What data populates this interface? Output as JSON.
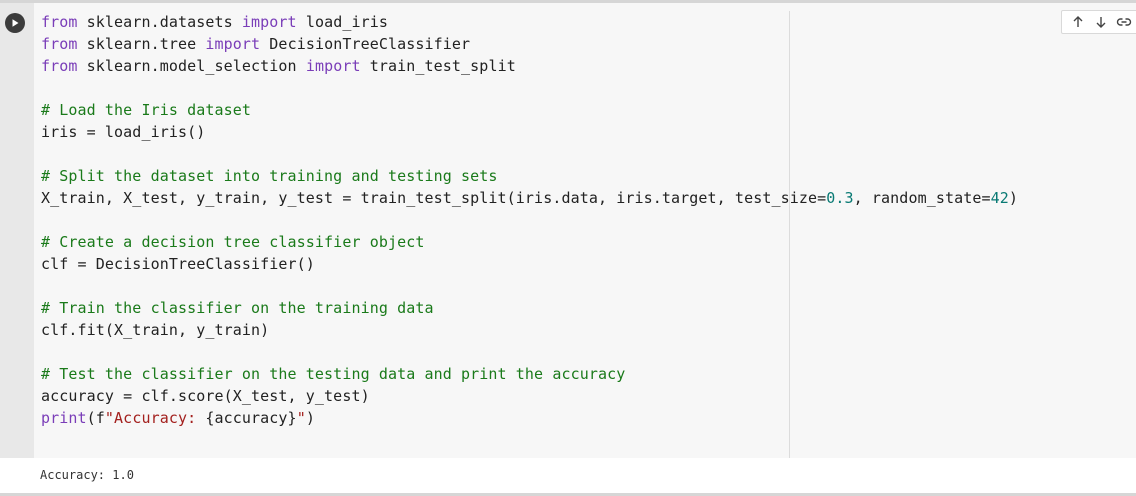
{
  "cell": {
    "code_lines": [
      [
        {
          "t": "from",
          "c": "kw"
        },
        {
          "t": " sklearn.datasets "
        },
        {
          "t": "import",
          "c": "kw"
        },
        {
          "t": " load_iris"
        }
      ],
      [
        {
          "t": "from",
          "c": "kw"
        },
        {
          "t": " sklearn.tree "
        },
        {
          "t": "import",
          "c": "kw"
        },
        {
          "t": " DecisionTreeClassifier"
        }
      ],
      [
        {
          "t": "from",
          "c": "kw"
        },
        {
          "t": " sklearn.model_selection "
        },
        {
          "t": "import",
          "c": "kw"
        },
        {
          "t": " train_test_split"
        }
      ],
      [],
      [
        {
          "t": "# Load the Iris dataset",
          "c": "cm"
        }
      ],
      [
        {
          "t": "iris = load_iris()"
        }
      ],
      [],
      [
        {
          "t": "# Split the dataset into training and testing sets",
          "c": "cm"
        }
      ],
      [
        {
          "t": "X_train, X_test, y_train, y_test = train_test_split(iris.data, iris.target, test_size="
        },
        {
          "t": "0.3",
          "c": "num"
        },
        {
          "t": ", random_state="
        },
        {
          "t": "42",
          "c": "num"
        },
        {
          "t": ")"
        }
      ],
      [],
      [
        {
          "t": "# Create a decision tree classifier object",
          "c": "cm"
        }
      ],
      [
        {
          "t": "clf = DecisionTreeClassifier()"
        }
      ],
      [],
      [
        {
          "t": "# Train the classifier on the training data",
          "c": "cm"
        }
      ],
      [
        {
          "t": "clf.fit(X_train, y_train)"
        }
      ],
      [],
      [
        {
          "t": "# Test the classifier on the testing data and print the accuracy",
          "c": "cm"
        }
      ],
      [
        {
          "t": "accuracy = clf.score(X_test, y_test)"
        }
      ],
      [
        {
          "t": "print",
          "c": "kw"
        },
        {
          "t": "(f"
        },
        {
          "t": "\"Accuracy: ",
          "c": "str"
        },
        {
          "t": "{accuracy}"
        },
        {
          "t": "\"",
          "c": "str"
        },
        {
          "t": ")"
        }
      ]
    ]
  },
  "output": {
    "text": "Accuracy: 1.0"
  },
  "icons": {
    "run": "play-icon",
    "up": "arrow-up-icon",
    "down": "arrow-down-icon",
    "link": "link-icon"
  },
  "colors": {
    "keyword": "#7a3db8",
    "comment": "#1a7a1a",
    "number": "#097a74",
    "string": "#a3201e"
  }
}
